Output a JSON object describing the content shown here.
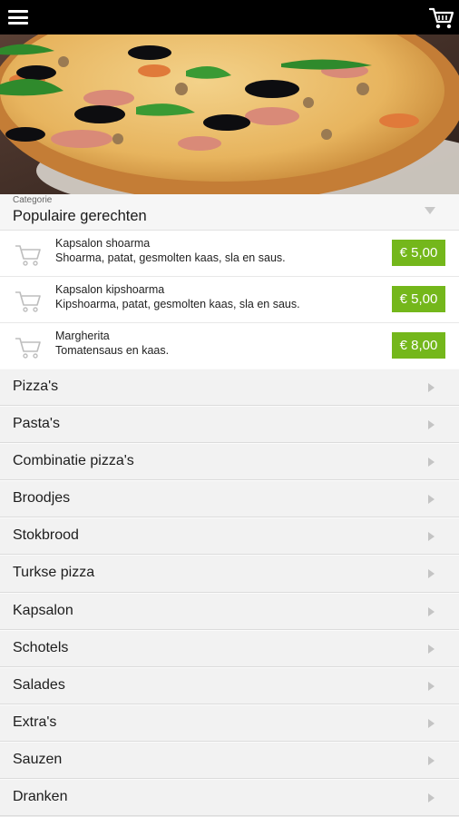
{
  "topbar": {
    "menu_icon": "hamburger-icon",
    "cart_icon": "shopping-cart-icon"
  },
  "category": {
    "caption": "Categorie",
    "selected": "Populaire gerechten"
  },
  "featured": [
    {
      "name": "Kapsalon shoarma",
      "description": "Shoarma, patat, gesmolten kaas, sla en saus.",
      "price": "€ 5,00"
    },
    {
      "name": "Kapsalon kipshoarma",
      "description": "Kipshoarma, patat, gesmolten kaas, sla en saus.",
      "price": "€ 5,00"
    },
    {
      "name": "Margherita",
      "description": "Tomatensaus en kaas.",
      "price": "€ 8,00"
    }
  ],
  "menu": [
    {
      "label": "Pizza's"
    },
    {
      "label": "Pasta's"
    },
    {
      "label": "Combinatie pizza's"
    },
    {
      "label": "Broodjes"
    },
    {
      "label": "Stokbrood"
    },
    {
      "label": "Turkse pizza"
    },
    {
      "label": "Kapsalon"
    },
    {
      "label": "Schotels"
    },
    {
      "label": "Salades"
    },
    {
      "label": "Extra's"
    },
    {
      "label": "Sauzen"
    },
    {
      "label": "Dranken"
    }
  ],
  "colors": {
    "topbar": "#000000",
    "price_badge": "#74b71b",
    "row_bg": "#f2f2f2"
  }
}
